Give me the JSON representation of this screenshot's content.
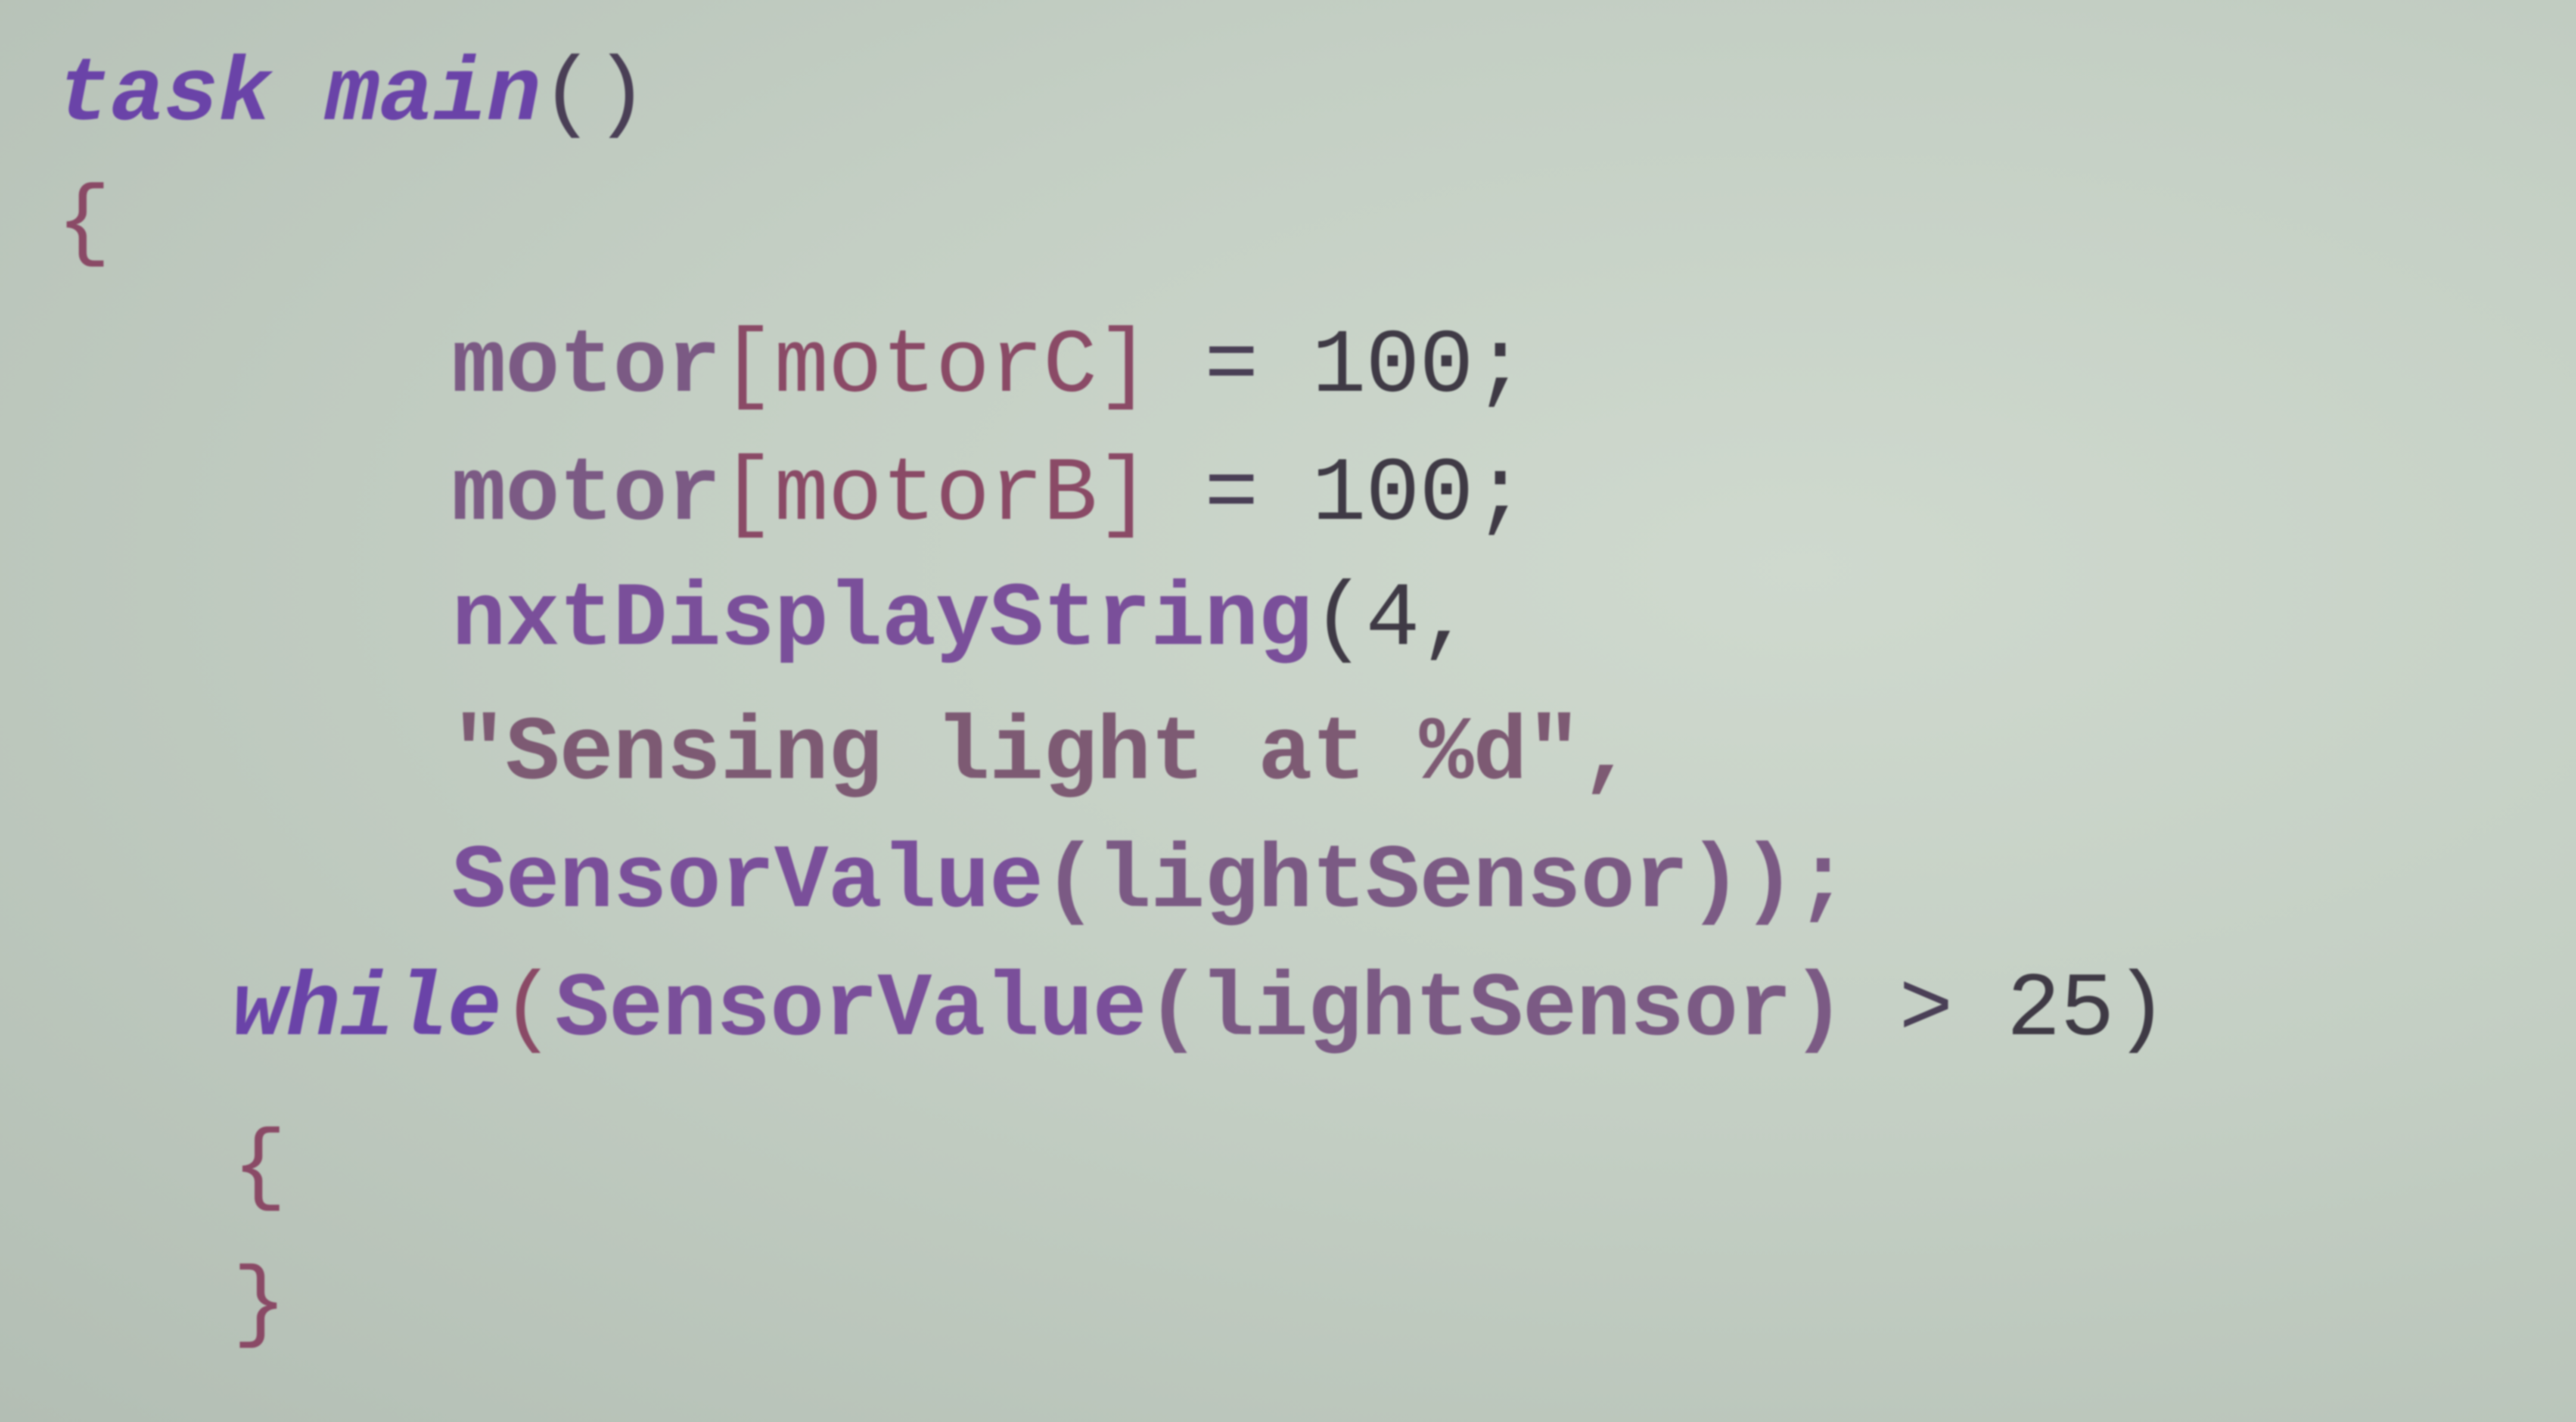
{
  "code_view": {
    "lines": [
      {
        "parts": [
          "task",
          "main",
          "()"
        ]
      },
      {
        "parts": [
          "{"
        ]
      },
      {
        "parts": [
          "motor",
          "[motorC]",
          "=",
          "100;"
        ]
      },
      {
        "parts": [
          "motor",
          "[motorB]",
          "=",
          "100;"
        ]
      },
      {
        "parts": [
          "nxtDisplayString",
          "(4,"
        ]
      },
      {
        "parts": [
          "\"Sensing light at %d\","
        ]
      },
      {
        "parts": [
          "SensorValue",
          "(lightSensor));"
        ]
      },
      {
        "parts": [
          "while",
          "(",
          "SensorValue",
          "(lightSensor)",
          ">",
          "25)"
        ]
      },
      {
        "parts": [
          "{"
        ]
      },
      {
        "parts": [
          "}"
        ]
      }
    ]
  }
}
